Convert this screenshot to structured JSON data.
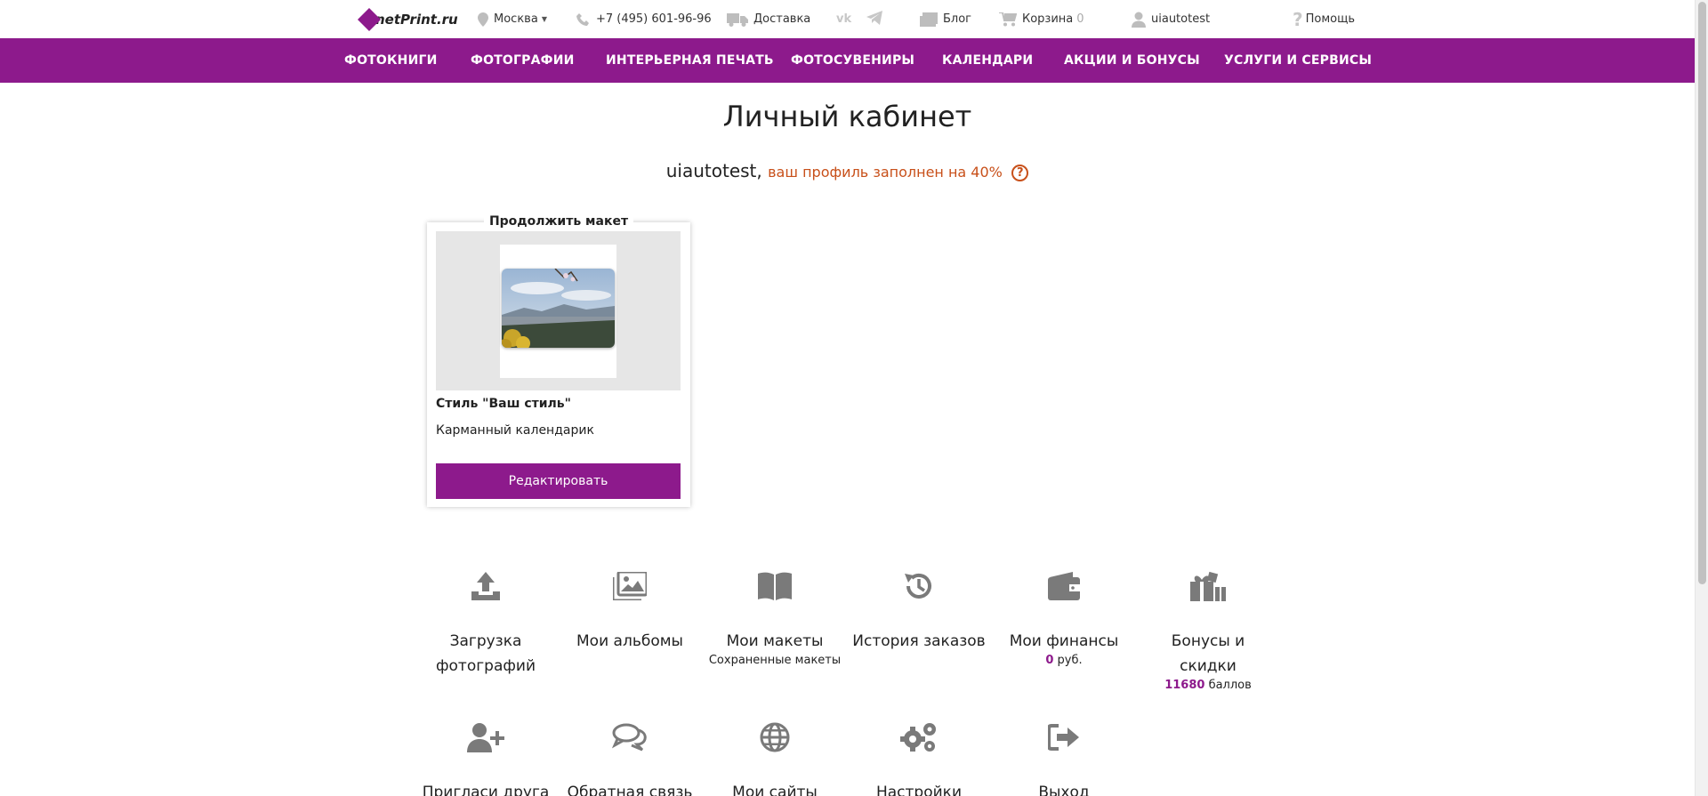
{
  "topbar": {
    "logo_text": "netPrint.ru",
    "city": "Москва",
    "phone": "+7 (495) 601-96-96",
    "delivery": "Доставка",
    "blog": "Блог",
    "cart": "Корзина",
    "cart_count": "0",
    "user": "uiautotest",
    "help": "Помощь"
  },
  "nav": {
    "items": [
      "ФОТОКНИГИ",
      "ФОТОГРАФИИ",
      "ИНТЕРЬЕРНАЯ ПЕЧАТЬ",
      "ФОТОСУВЕНИРЫ",
      "КАЛЕНДАРИ",
      "АКЦИИ И БОНУСЫ",
      "УСЛУГИ И СЕРВИСЫ"
    ]
  },
  "page": {
    "title": "Личный кабинет",
    "username": "uiautotest,",
    "profile_fill": "ваш профиль заполнен на 40%",
    "help_glyph": "?"
  },
  "card": {
    "label": "Продолжить макет",
    "title": "Стиль \"Ваш стиль\"",
    "subtitle": "Карманный календарик",
    "button": "Редактировать"
  },
  "menu": {
    "upload": "Загрузка фотографий",
    "albums": "Мои альбомы",
    "layouts": "Мои макеты",
    "layouts_sub": "Сохраненные макеты",
    "history": "История заказов",
    "finance": "Мои финансы",
    "finance_value": "0",
    "finance_unit": "руб.",
    "bonus": "Бонусы и скидки",
    "bonus_value": "11680",
    "bonus_unit": "баллов",
    "invite": "Пригласи друга",
    "feedback": "Обратная связь",
    "sites": "Мои сайты",
    "settings": "Настройки",
    "logout": "Выход"
  },
  "colors": {
    "brand": "#8d1a8c",
    "accent_orange": "#c8501a",
    "icon_gray": "#7a7a7a"
  }
}
